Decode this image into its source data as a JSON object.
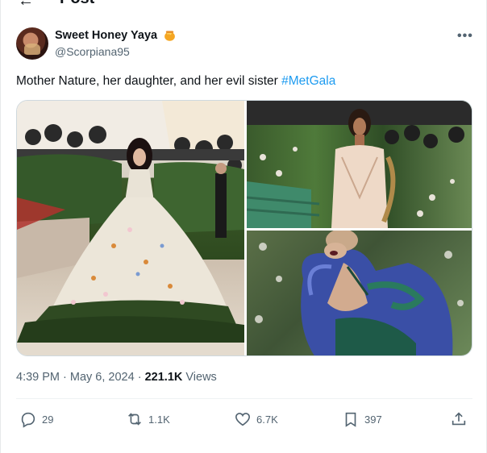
{
  "header": {
    "back_icon": "arrow-left-icon",
    "title": "Post"
  },
  "author": {
    "name": "Sweet Honey Yaya",
    "badge_icon": "honeypot-emoji-icon",
    "handle": "@Scorpiana95",
    "more_icon": "more-dots-icon"
  },
  "tweet": {
    "text": "Mother Nature, her daughter, and her evil sister ",
    "hashtag": "#MetGala",
    "hashtag_color": "#1d9bf0"
  },
  "media": {
    "images": [
      "photo-floral-gown-on-stairs",
      "photo-corset-gown-garden",
      "photo-blue-gown-closeup"
    ]
  },
  "meta": {
    "time": "4:39 PM",
    "sep1": " · ",
    "date": "May 6, 2024",
    "sep2": " · ",
    "views_count": "221.1K",
    "views_label": " Views"
  },
  "actions": {
    "reply": {
      "icon": "reply-icon",
      "count": "29"
    },
    "repost": {
      "icon": "repost-icon",
      "count": "1.1K"
    },
    "like": {
      "icon": "heart-icon",
      "count": "6.7K"
    },
    "bookmark": {
      "icon": "bookmark-icon",
      "count": "397"
    },
    "share": {
      "icon": "share-icon"
    }
  }
}
